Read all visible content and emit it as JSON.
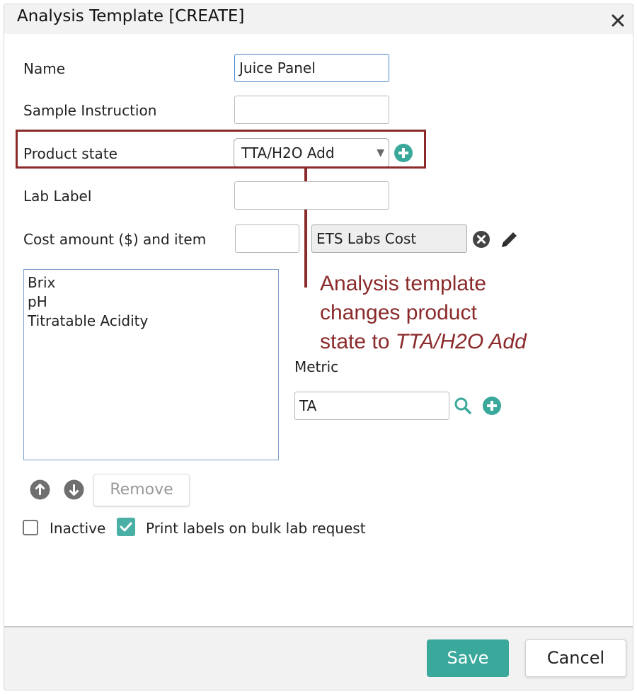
{
  "dialog": {
    "title": "Analysis Template [CREATE]",
    "close_icon": "close-icon"
  },
  "form": {
    "name_label": "Name",
    "name_value": "Juice Panel",
    "sample_instruction_label": "Sample Instruction",
    "sample_instruction_value": "",
    "product_state_label": "Product state",
    "product_state_value": "TTA/H2O Add",
    "lab_label_label": "Lab Label",
    "lab_label_value": "",
    "cost_label": "Cost amount ($) and item",
    "cost_amount_value": "",
    "cost_item_value": "ETS Labs Cost"
  },
  "metrics_list": [
    "Brix",
    "pH",
    "Titratable Acidity"
  ],
  "metric": {
    "label": "Metric",
    "value": "TA"
  },
  "list_controls": {
    "remove_label": "Remove"
  },
  "checkboxes": {
    "inactive_label": "Inactive",
    "inactive_checked": false,
    "print_labels_label": "Print labels on bulk lab request",
    "print_labels_checked": true
  },
  "annotation": {
    "line1": "Analysis template",
    "line2": "changes product",
    "line3_prefix": "state to ",
    "line3_emph": "TTA/H2O Add",
    "color": "#8b2a2a"
  },
  "footer": {
    "save_label": "Save",
    "cancel_label": "Cancel"
  },
  "colors": {
    "accent": "#3aa89b"
  }
}
